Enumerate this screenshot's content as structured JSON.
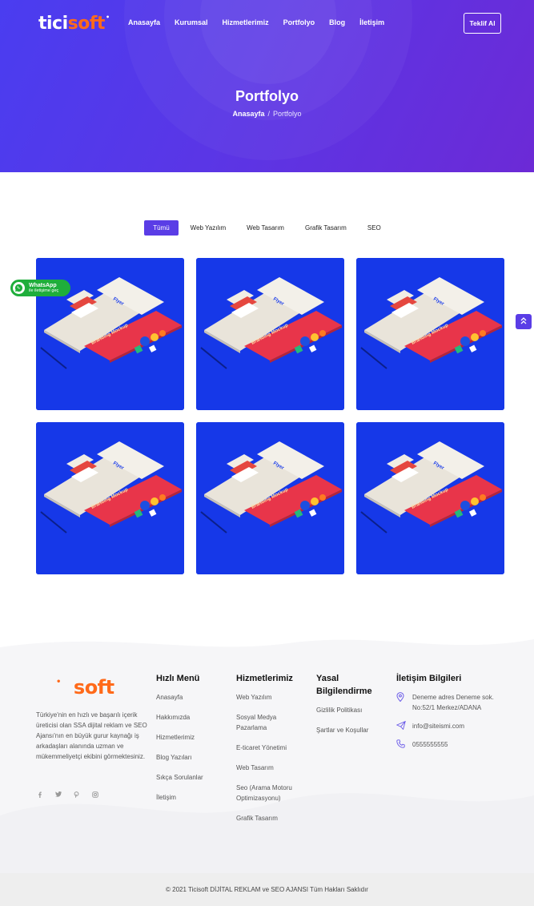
{
  "brand": {
    "part1": "tici",
    "part2": "soft",
    "mark": "•"
  },
  "nav": {
    "items": [
      "Anasayfa",
      "Kurumsal",
      "Hizmetlerimiz",
      "Portfolyo",
      "Blog",
      "İletişim"
    ],
    "cta": "Teklif Al"
  },
  "hero": {
    "title": "Portfolyo",
    "breadcrumb_home": "Anasayfa",
    "breadcrumb_sep": "/",
    "breadcrumb_current": "Portfolyo"
  },
  "filters": {
    "items": [
      "Tümü",
      "Web Yazılım",
      "Web Tasarım",
      "Grafik Tasarım",
      "SEO"
    ],
    "active": "Tümü"
  },
  "portfolio": {
    "count": 6,
    "image_label": "Flyer Branding Mockup"
  },
  "whatsapp": {
    "title": "WhatsApp",
    "subtitle": "ile iletişime geç"
  },
  "footer": {
    "logo_text": "soft",
    "description": "Türkiye'nin en hızlı ve başarılı içerik üreticisi olan SSA dijital reklam ve SEO Ajansı'nın en büyük gurur kaynağı iş arkadaşları alanında uzman ve mükemmeliyetçi ekibini görmektesiniz.",
    "quick_menu": {
      "title": "Hızlı Menü",
      "items": [
        "Anasayfa",
        "Hakkımızda",
        "Hizmetlerimiz",
        "Blog Yazıları",
        "Sıkça Sorulanlar",
        "İletişim"
      ]
    },
    "services": {
      "title": "Hizmetlerimiz",
      "items": [
        "Web Yazılım",
        "Sosyal Medya Pazarlama",
        "E-ticaret Yönetimi",
        "Web Tasarım",
        "Seo (Arama Motoru Optimizasyonu)",
        "Grafik Tasarım"
      ]
    },
    "legal": {
      "title": "Yasal Bilgilendirme",
      "items": [
        "Gizlilik Politikası",
        "Şartlar ve Koşullar"
      ]
    },
    "contact": {
      "title": "İletişim Bilgileri",
      "address": "Deneme adres Deneme sok. No:52/1 Merkez/ADANA",
      "email": "info@siteismi.com",
      "phone": "0555555555"
    }
  },
  "copyright": "© 2021 Ticisoft DİJİTAL REKLAM ve SEO AJANSI Tüm Hakları Saklıdır",
  "colors": {
    "primary": "#5a3de6",
    "brand_orange": "#ff6a1a",
    "card_blue": "#1638e8",
    "whatsapp_green": "#1fae3b"
  }
}
